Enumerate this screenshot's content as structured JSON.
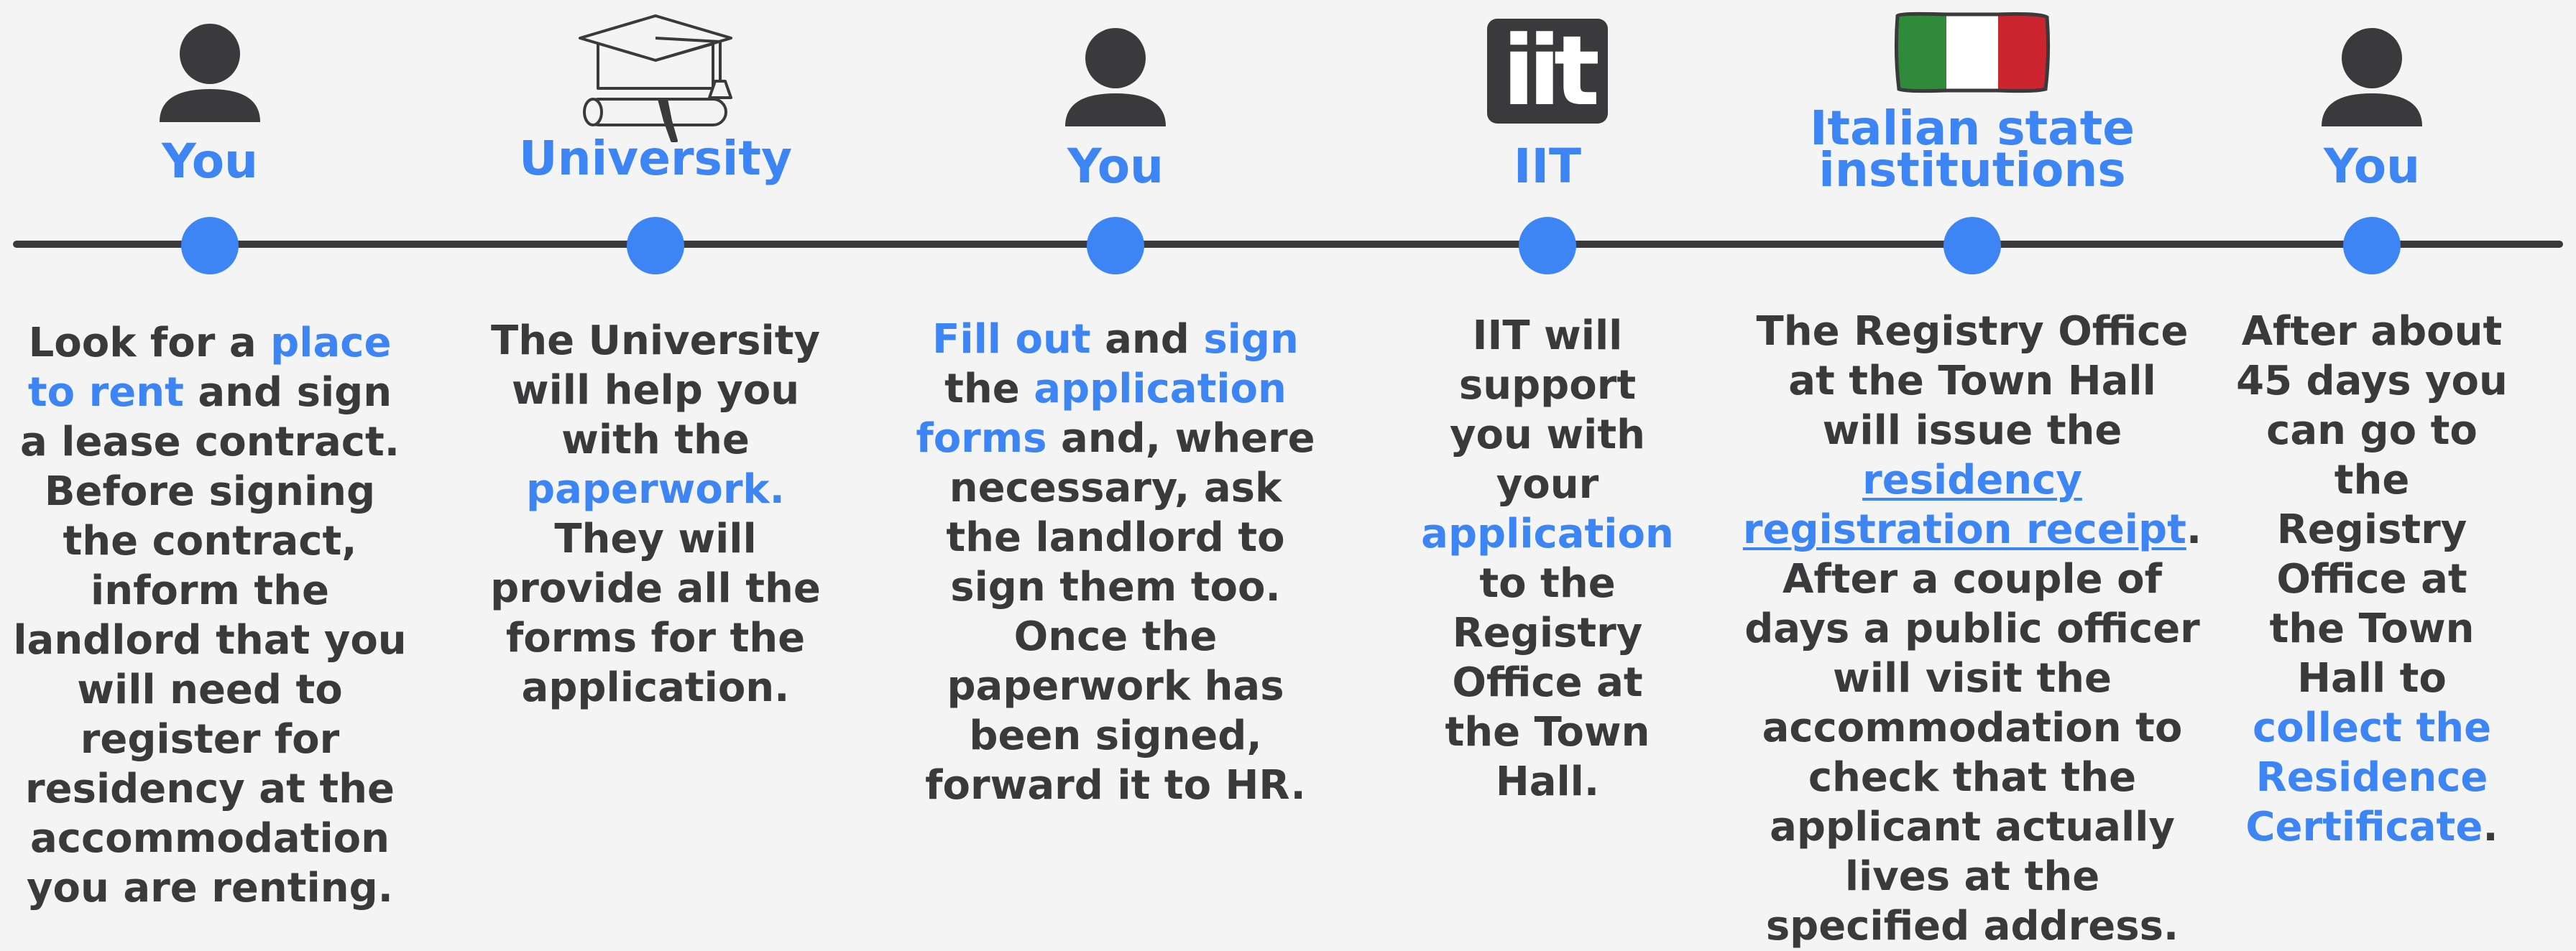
{
  "colors": {
    "accent": "#3d85f4",
    "text": "#3a3a3c",
    "background": "#f4f4f4"
  },
  "steps": [
    {
      "actor": "You",
      "icon": "person-icon",
      "description": [
        {
          "t": "Look for a "
        },
        {
          "t": "place to rent",
          "s": "hl"
        },
        {
          "t": " and sign a lease contract. Before signing the contract, inform the landlord that you will need to register for residency at the accommodation you are renting."
        }
      ]
    },
    {
      "actor": "University",
      "icon": "graduation-cap-diploma-icon",
      "description": [
        {
          "t": "The University will help you with the "
        },
        {
          "t": "paperwork.",
          "s": "hl"
        },
        {
          "t": " They will provide all the forms for the application."
        }
      ]
    },
    {
      "actor": "You",
      "icon": "person-icon",
      "description": [
        {
          "t": "Fill out",
          "s": "hl"
        },
        {
          "t": " and "
        },
        {
          "t": "sign",
          "s": "hl"
        },
        {
          "t": " the "
        },
        {
          "t": "application forms",
          "s": "hl"
        },
        {
          "t": " and, where necessary, ask the landlord to sign them too. Once the paperwork has been signed, forward it to HR."
        }
      ]
    },
    {
      "actor": "IIT",
      "icon": "iit-logo-icon",
      "logo_text": "iit",
      "description": [
        {
          "t": "IIT will support you with your "
        },
        {
          "t": "application",
          "s": "hl"
        },
        {
          "t": " to the Registry Office at the Town Hall."
        }
      ]
    },
    {
      "actor": "Italian state\ninstitutions",
      "icon": "italian-flag-icon",
      "description": [
        {
          "t": "The Registry Office at the Town Hall will issue the "
        },
        {
          "t": "residency registration receipt",
          "s": "ul"
        },
        {
          "t": ". After a couple of days a public officer will visit the accommodation to check that the applicant actually lives at the specified address."
        }
      ]
    },
    {
      "actor": "You",
      "icon": "person-icon",
      "description": [
        {
          "t": "After about 45 days you can go to the Registry Office at the Town Hall to "
        },
        {
          "t": "collect the Residence Certificate",
          "s": "hl"
        },
        {
          "t": "."
        }
      ]
    }
  ]
}
